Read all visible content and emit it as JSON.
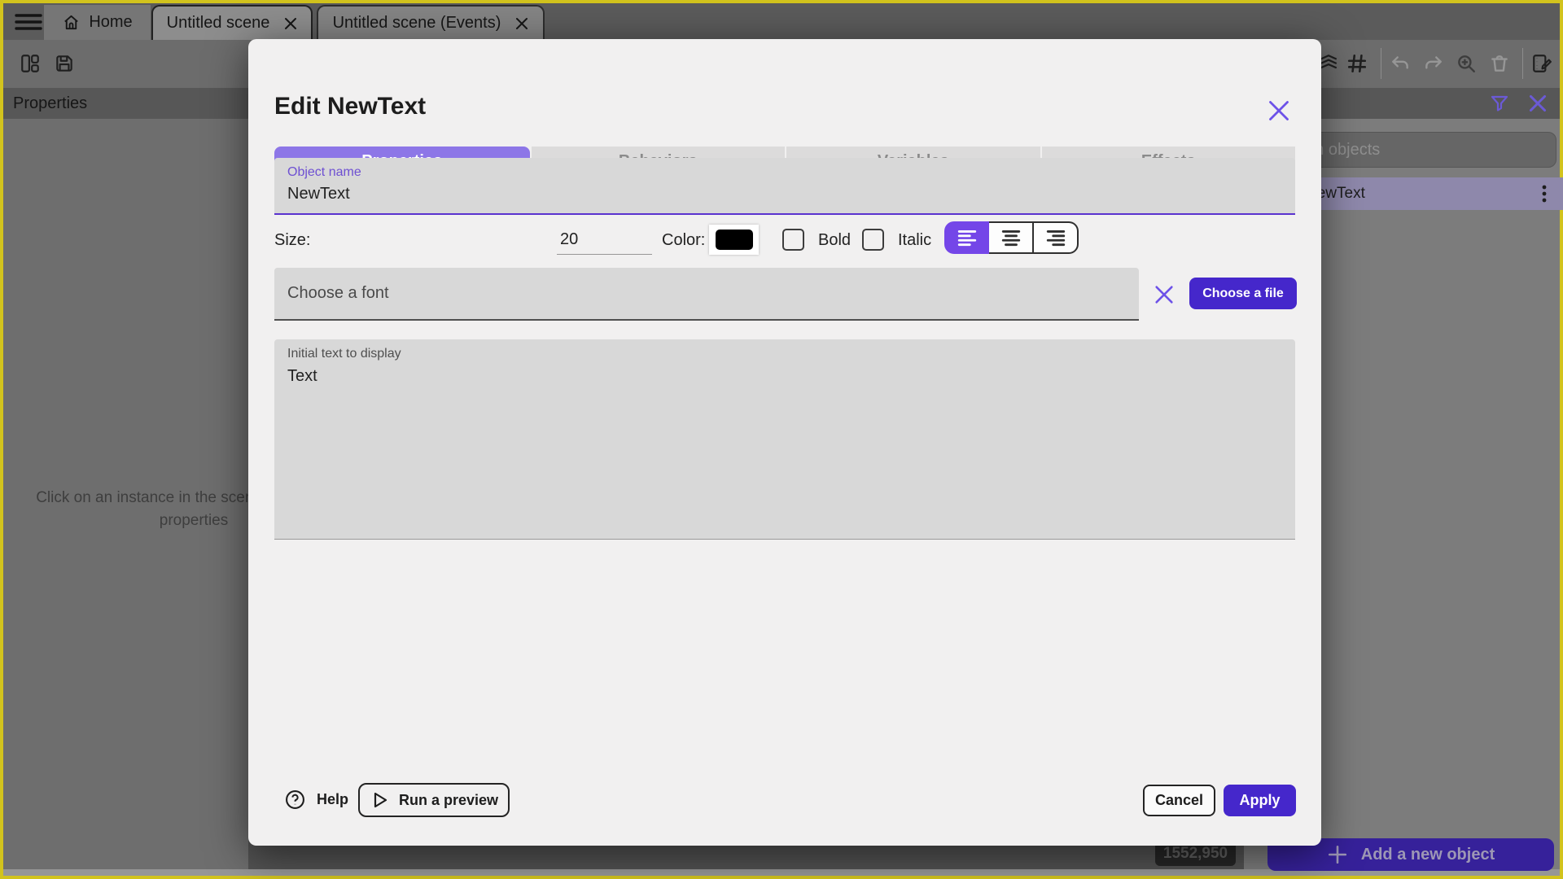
{
  "top_bar": {
    "home_tab": {
      "label": "Home"
    },
    "scene_tab": {
      "label": "Untitled scene"
    },
    "events_tab": {
      "label": "Untitled scene (Events)"
    }
  },
  "left_panel": {
    "header": "Properties",
    "empty_message": "Click on an instance in the scene to display its properties"
  },
  "right_panel": {
    "search_placeholder": "Search objects",
    "objects": [
      {
        "name": "NewText"
      }
    ],
    "add_button_label": "Add a new object",
    "coords_badge": "1552,950"
  },
  "dialog": {
    "title": "Edit NewText",
    "tabs": [
      "Properties",
      "Behaviors",
      "Variables",
      "Effects"
    ],
    "active_tab": "Properties",
    "object_name": {
      "label": "Object name",
      "value": "NewText"
    },
    "size": {
      "label": "Size:",
      "value": "20"
    },
    "color": {
      "label": "Color:",
      "value_hex": "#000000"
    },
    "bold": {
      "label": "Bold",
      "checked": false
    },
    "italic": {
      "label": "Italic",
      "checked": false
    },
    "alignment": "left",
    "font_field": {
      "placeholder": "Choose a font"
    },
    "choose_file_label": "Choose a file",
    "initial_text": {
      "label": "Initial text to display",
      "value": "Text"
    },
    "help_label": "Help",
    "run_preview_label": "Run a preview",
    "cancel_label": "Cancel",
    "apply_label": "Apply"
  },
  "colors": {
    "accent": "#4527cb",
    "active_tab_bg": "#8d76e7",
    "active_tab_underline": "#6a3fd8",
    "field_underline": "#5b33cf",
    "dialog_bg": "#f1f0f0",
    "window_border": "#d2c31d",
    "text_color_swatch": "#000000"
  }
}
